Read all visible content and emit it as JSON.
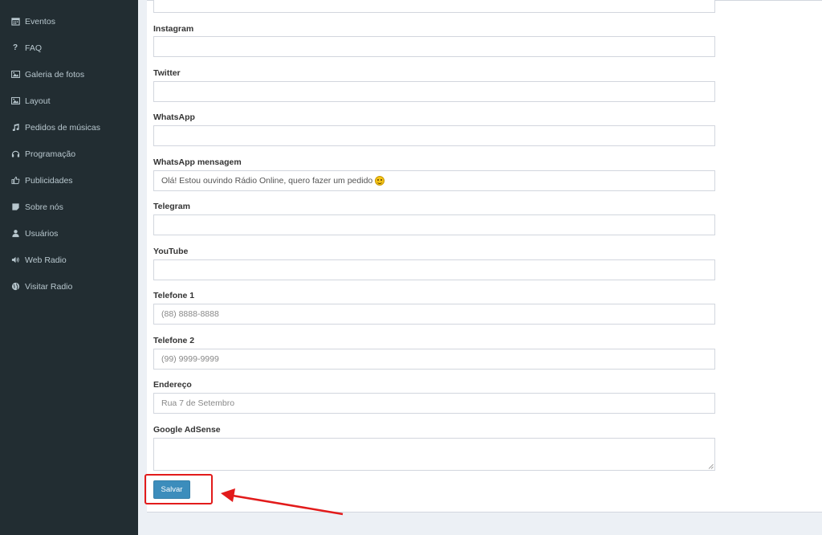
{
  "sidebar": {
    "items": [
      {
        "label": "Eventos",
        "icon": "calendar-icon"
      },
      {
        "label": "FAQ",
        "icon": "question-icon"
      },
      {
        "label": "Galeria de fotos",
        "icon": "image-icon"
      },
      {
        "label": "Layout",
        "icon": "image-icon"
      },
      {
        "label": "Pedidos de músicas",
        "icon": "music-icon"
      },
      {
        "label": "Programação",
        "icon": "headphones-icon"
      },
      {
        "label": "Publicidades",
        "icon": "thumbs-up-icon"
      },
      {
        "label": "Sobre nós",
        "icon": "sticky-note-icon"
      },
      {
        "label": "Usuários",
        "icon": "user-icon"
      },
      {
        "label": "Web Radio",
        "icon": "volume-icon"
      },
      {
        "label": "Visitar Radio",
        "icon": "globe-icon"
      }
    ]
  },
  "form": {
    "fields": [
      {
        "label": "Instagram",
        "value": "",
        "placeholder": ""
      },
      {
        "label": "Twitter",
        "value": "",
        "placeholder": ""
      },
      {
        "label": "WhatsApp",
        "value": "",
        "placeholder": ""
      },
      {
        "label": "WhatsApp mensagem",
        "value": "Olá! Estou ouvindo Rádio Online, quero fazer um pedido",
        "placeholder": ""
      },
      {
        "label": "Telegram",
        "value": "",
        "placeholder": ""
      },
      {
        "label": "YouTube",
        "value": "",
        "placeholder": ""
      },
      {
        "label": "Telefone 1",
        "value": "",
        "placeholder": "(88) 8888-8888"
      },
      {
        "label": "Telefone 2",
        "value": "",
        "placeholder": "(99) 9999-9999"
      },
      {
        "label": "Endereço",
        "value": "",
        "placeholder": "Rua 7 de Setembro"
      }
    ],
    "adsense_label": "Google AdSense",
    "adsense_value": "",
    "save_label": "Salvar"
  },
  "colors": {
    "sidebar_bg": "#222d32",
    "primary_button": "#3c8dbc",
    "annotation_red": "#e21b1b"
  }
}
